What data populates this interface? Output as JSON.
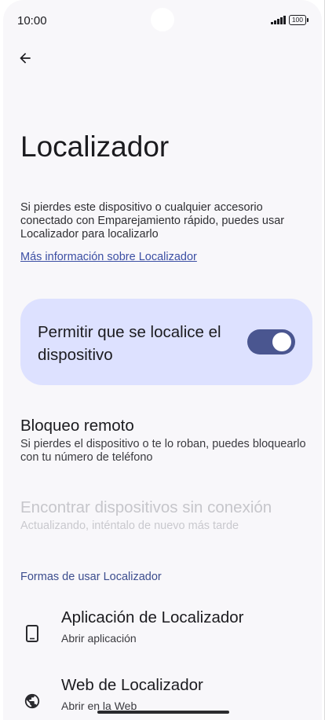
{
  "status_bar": {
    "time": "10:00",
    "battery": "100"
  },
  "page": {
    "title": "Localizador",
    "description": "Si pierdes este dispositivo o cualquier accesorio conectado con Emparejamiento rápido, puedes usar Localizador para localizarlo",
    "learn_more": "Más información sobre Localizador"
  },
  "main_toggle": {
    "label": "Permitir que se localice el dispositivo",
    "enabled": true
  },
  "settings": [
    {
      "title": "Bloqueo remoto",
      "subtitle": "Si pierdes el dispositivo o te lo roban, puedes bloquearlo con tu número de teléfono",
      "disabled": false
    },
    {
      "title": "Encontrar dispositivos sin conexión",
      "subtitle": "Actualizando, inténtalo de nuevo más tarde",
      "disabled": true
    }
  ],
  "ways_section": {
    "header": "Formas de usar Localizador",
    "items": [
      {
        "title": "Aplicación de Localizador",
        "subtitle": "Abrir aplicación",
        "icon": "phone-icon"
      },
      {
        "title": "Web de Localizador",
        "subtitle": "Abrir en la Web",
        "icon": "globe-icon"
      }
    ]
  },
  "colors": {
    "background": "#f8f7fa",
    "card": "#dde1ff",
    "switch_track": "#4a5690",
    "link": "#3c4fa4",
    "section_header": "#3c4d8e"
  }
}
